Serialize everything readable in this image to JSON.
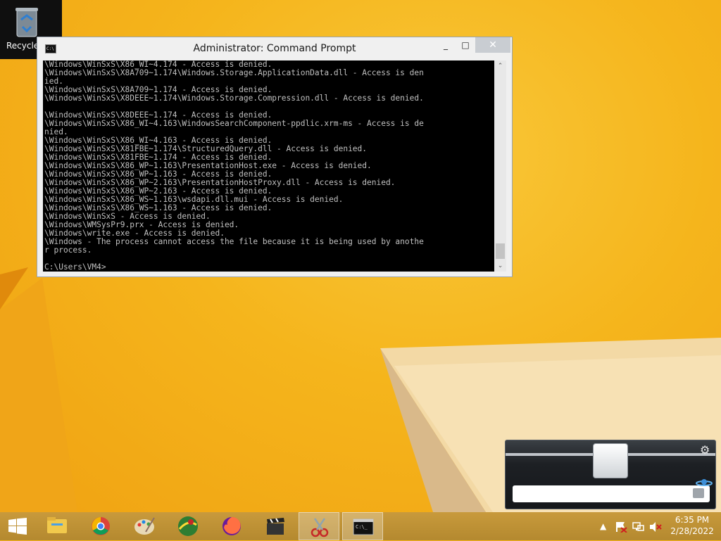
{
  "desktop": {
    "recycle_bin_label": "Recycle"
  },
  "cmd": {
    "title": "Administrator: Command Prompt",
    "minimize_glyph": "_",
    "maximize_glyph": "□",
    "close_glyph": "✕",
    "app_icon_text": "C:\\",
    "output": "\\Windows\\WinSxS\\X86_WI~4.174 - Access is denied.\n\\Windows\\WinSxS\\X8A709~1.174\\Windows.Storage.ApplicationData.dll - Access is den\nied.\n\\Windows\\WinSxS\\X8A709~1.174 - Access is denied.\n\\Windows\\WinSxS\\X8DEEE~1.174\\Windows.Storage.Compression.dll - Access is denied.\n\n\\Windows\\WinSxS\\X8DEEE~1.174 - Access is denied.\n\\Windows\\WinSxS\\X86_WI~4.163\\WindowsSearchComponent-ppdlic.xrm-ms - Access is de\nnied.\n\\Windows\\WinSxS\\X86_WI~4.163 - Access is denied.\n\\Windows\\WinSxS\\X81FBE~1.174\\StructuredQuery.dll - Access is denied.\n\\Windows\\WinSxS\\X81FBE~1.174 - Access is denied.\n\\Windows\\WinSxS\\X86_WP~1.163\\PresentationHost.exe - Access is denied.\n\\Windows\\WinSxS\\X86_WP~1.163 - Access is denied.\n\\Windows\\WinSxS\\X86_WP~2.163\\PresentationHostProxy.dll - Access is denied.\n\\Windows\\WinSxS\\X86_WP~2.163 - Access is denied.\n\\Windows\\WinSxS\\X86_WS~1.163\\wsdapi.dll.mui - Access is denied.\n\\Windows\\WinSxS\\X86_WS~1.163 - Access is denied.\n\\Windows\\WinSxS - Access is denied.\n\\Windows\\WMSysPr9.prx - Access is denied.\n\\Windows\\write.exe - Access is denied.\n\\Windows - The process cannot access the file because it is being used by anothe\nr process.\n\nC:\\Users\\VM4>"
  },
  "volume_flyout": {
    "level_fraction": 0.5,
    "gear_glyph": "⚙"
  },
  "taskbar": {
    "items": [
      {
        "name": "file-explorer"
      },
      {
        "name": "chrome"
      },
      {
        "name": "paint"
      },
      {
        "name": "map-app"
      },
      {
        "name": "firefox"
      },
      {
        "name": "video-editor"
      },
      {
        "name": "snipping-tool",
        "active": true
      },
      {
        "name": "command-prompt",
        "active": true
      }
    ],
    "clock": {
      "time": "6:35 PM",
      "date": "2/28/2022"
    },
    "tray_up_glyph": "▲"
  },
  "colors": {
    "wallpaper": "#f4b21a",
    "console_bg": "#000000",
    "console_text": "#c0c0c0"
  }
}
